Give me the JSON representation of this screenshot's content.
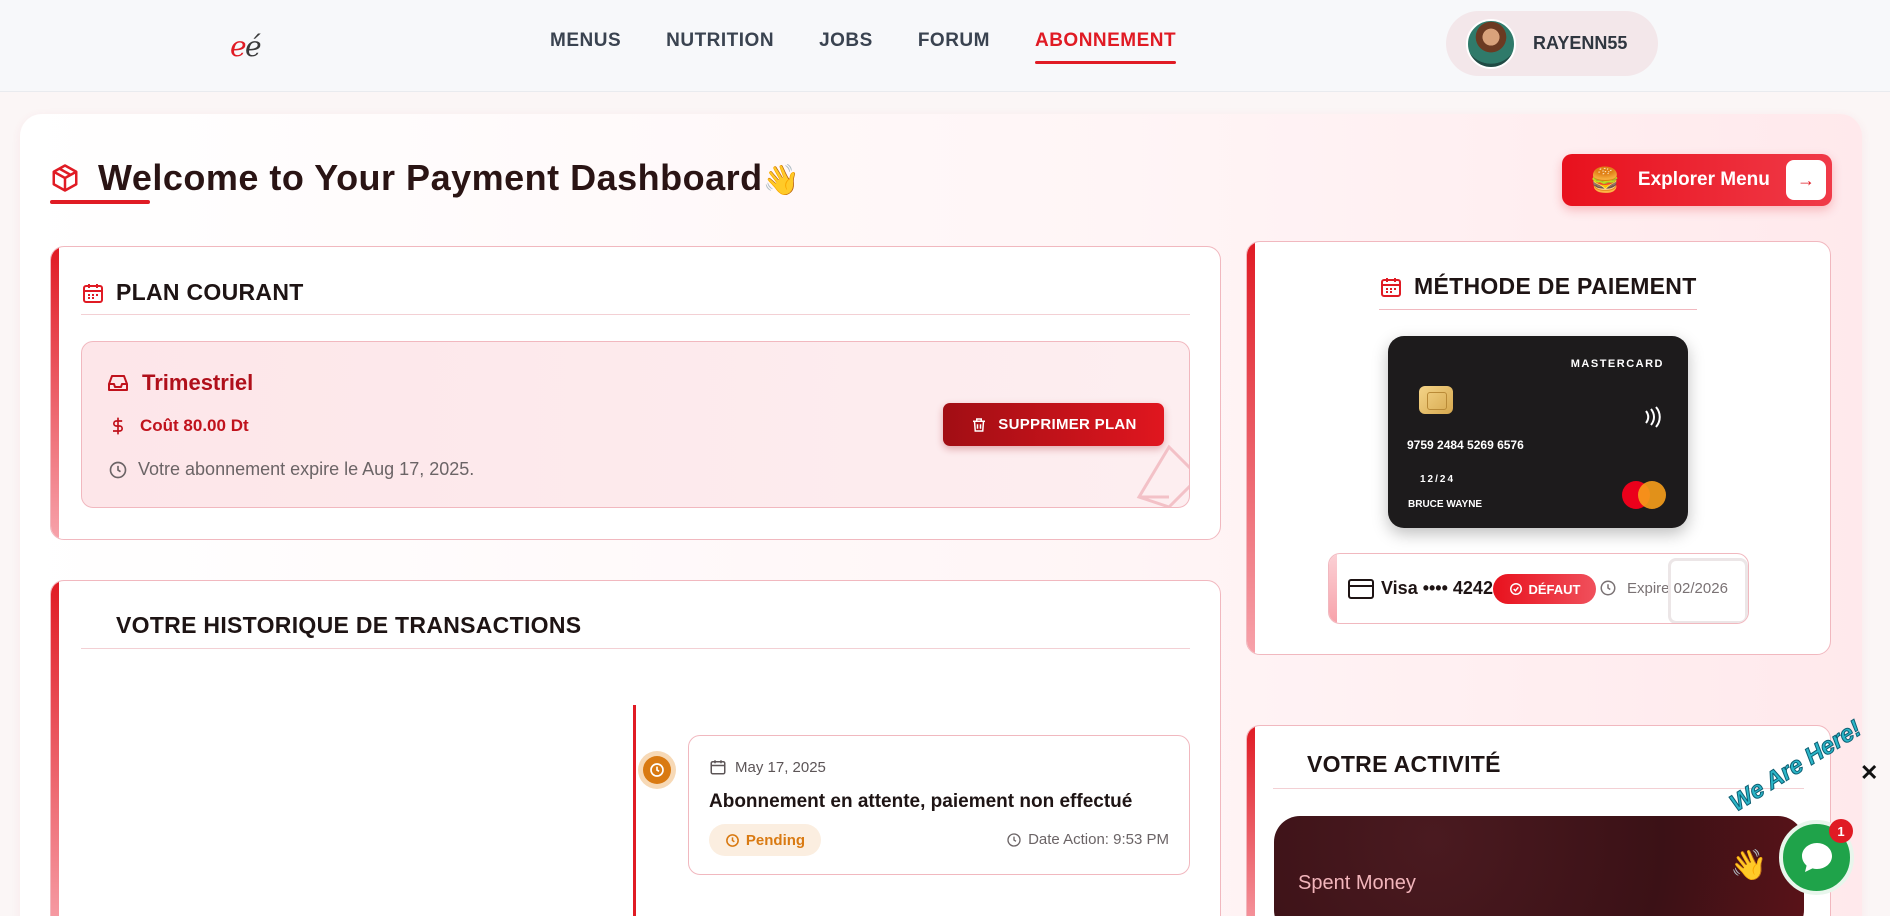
{
  "header": {
    "logo_alt": "eé",
    "nav": [
      {
        "label": "MENUS",
        "active": false
      },
      {
        "label": "NUTRITION",
        "active": false
      },
      {
        "label": "JOBS",
        "active": false
      },
      {
        "label": "FORUM",
        "active": false
      },
      {
        "label": "ABONNEMENT",
        "active": true
      }
    ],
    "user": {
      "name": "RAYENN55"
    }
  },
  "page": {
    "title": "Welcome to Your Payment Dashboard",
    "title_emoji": "👋",
    "explore_button": {
      "emoji": "🍔",
      "label": "Explorer Menu",
      "arrow": "→"
    }
  },
  "plan": {
    "section_title": "PLAN COURANT",
    "name": "Trimestriel",
    "cost": "Coût 80.00 Dt",
    "expiry": "Votre abonnement expire le Aug 17, 2025.",
    "delete_label": "SUPPRIMER PLAN"
  },
  "payment": {
    "section_title": "MÉTHODE DE PAIEMENT",
    "card": {
      "brand": "MASTERCARD",
      "number": "9759 2484 5269 6576",
      "expiry": "12/24",
      "holder": "BRUCE WAYNE"
    },
    "saved_method": {
      "label": "Visa •••• 4242",
      "badge": "DÉFAUT",
      "expiry": "Expire 02/2026"
    }
  },
  "transactions": {
    "section_title": "VOTRE HISTORIQUE DE TRANSACTIONS",
    "items": [
      {
        "date": "May 17, 2025",
        "title": "Abonnement en attente, paiement non effectué",
        "status": "Pending",
        "time": "Date Action: 9:53 PM"
      }
    ]
  },
  "activity": {
    "section_title": "VOTRE ACTIVITÉ",
    "card_label": "Spent Money"
  },
  "chat": {
    "tagline": "We Are Here!",
    "badge_count": "1",
    "close": "✕"
  },
  "colors": {
    "accent": "#e01b24",
    "pending": "#d97a12",
    "chat_green": "#1fa34a"
  }
}
